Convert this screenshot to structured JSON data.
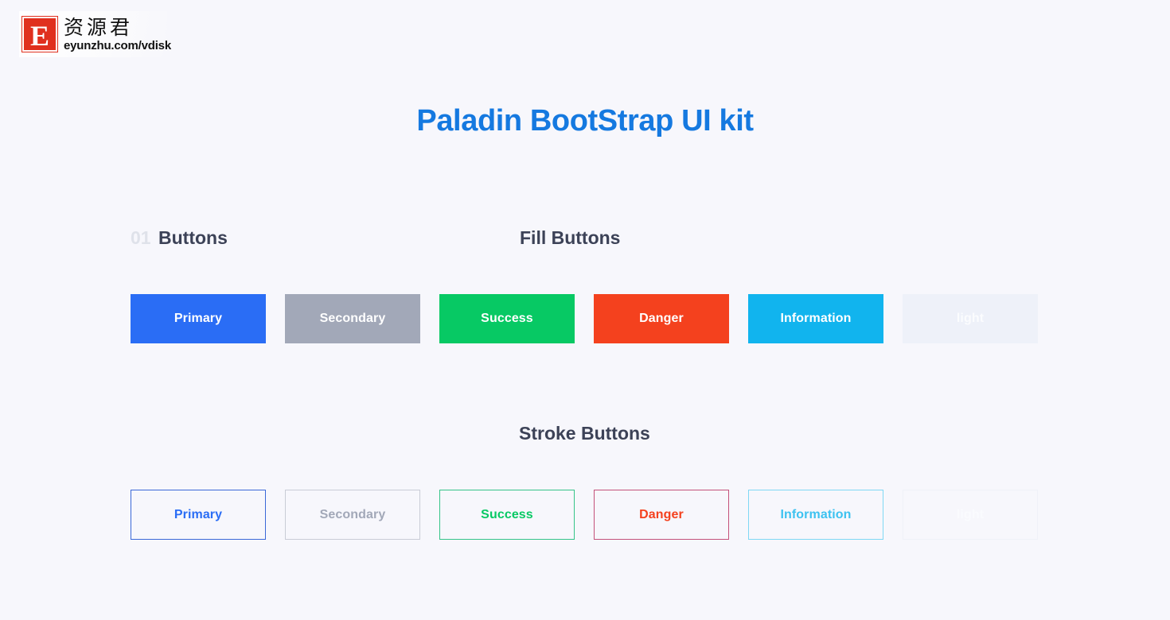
{
  "watermark": {
    "badge_letter": "E",
    "brand_cn": "资源君",
    "url": "eyunzhu.com/vdisk"
  },
  "page": {
    "title": "Paladin BootStrap UI kit",
    "title_color": "#1579e0",
    "background_color": "#f7f7fc"
  },
  "section": {
    "number": "01",
    "number_color": "#dfe2ea",
    "title": "Buttons",
    "title_color": "#3c4257"
  },
  "groups": {
    "fill": {
      "title": "Fill Buttons",
      "buttons": [
        {
          "label": "Primary",
          "bg": "#2a6df5",
          "text_color": "#ffffff"
        },
        {
          "label": "Secondary",
          "bg": "#a2a8b8",
          "text_color": "#ffffff"
        },
        {
          "label": "Success",
          "bg": "#07c964",
          "text_color": "#ffffff"
        },
        {
          "label": "Danger",
          "bg": "#f4411e",
          "text_color": "#ffffff"
        },
        {
          "label": "Information",
          "bg": "#11b4ee",
          "text_color": "#ffffff"
        },
        {
          "label": "light",
          "bg": "#eef1f9",
          "text_color": "#fbfcfe"
        }
      ]
    },
    "stroke": {
      "title": "Stroke Buttons",
      "buttons": [
        {
          "label": "Primary",
          "border": "#3a68d8",
          "text_color": "#2a6df5"
        },
        {
          "label": "Secondary",
          "border": "#c9ccd6",
          "text_color": "#a2a8b8"
        },
        {
          "label": "Success",
          "border": "#35c489",
          "text_color": "#07c964"
        },
        {
          "label": "Danger",
          "border": "#c4517a",
          "text_color": "#f4411e"
        },
        {
          "label": "Information",
          "border": "#7fd8f4",
          "text_color": "#3dc2f0"
        },
        {
          "label": "light",
          "border": "#eff1f8",
          "text_color": "#fafbfe"
        }
      ]
    }
  }
}
